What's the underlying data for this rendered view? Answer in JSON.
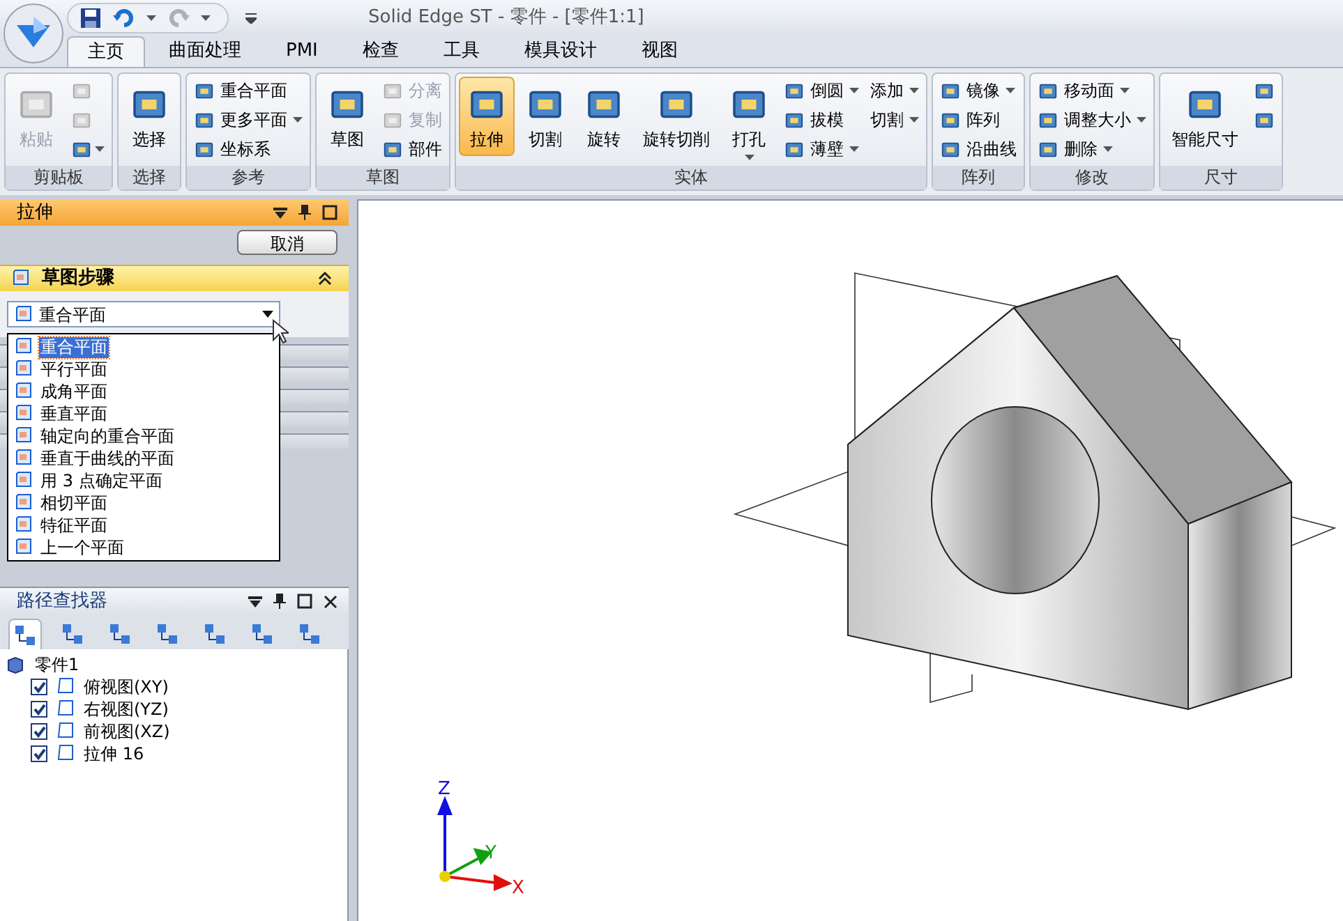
{
  "app_title": "Solid Edge ST - 零件 - [零件1:1]",
  "ribbon_tabs": [
    {
      "label": "主页",
      "selected": true
    },
    {
      "label": "曲面处理",
      "selected": false
    },
    {
      "label": "PMI",
      "selected": false
    },
    {
      "label": "检查",
      "selected": false
    },
    {
      "label": "工具",
      "selected": false
    },
    {
      "label": "模具设计",
      "selected": false
    },
    {
      "label": "视图",
      "selected": false
    }
  ],
  "ribbon_groups": [
    {
      "label": "剪贴板",
      "items": [
        {
          "kind": "large",
          "label": "粘贴",
          "disabled": true,
          "selected": false,
          "dropdown": false
        },
        {
          "kind": "icon",
          "disabled": true,
          "selected": false,
          "dropdown": false
        },
        {
          "kind": "icon",
          "disabled": true,
          "selected": false,
          "dropdown": false
        },
        {
          "kind": "icon",
          "disabled": false,
          "selected": false,
          "dropdown": true
        }
      ]
    },
    {
      "label": "选择",
      "items": [
        {
          "kind": "large",
          "label": "选择",
          "disabled": false,
          "selected": false,
          "dropdown": false
        }
      ]
    },
    {
      "label": "参考",
      "items": [
        {
          "kind": "small",
          "label": "重合平面",
          "disabled": false,
          "selected": false,
          "dropdown": false
        },
        {
          "kind": "small",
          "label": "更多平面",
          "disabled": false,
          "selected": false,
          "dropdown": true
        },
        {
          "kind": "small",
          "label": "坐标系",
          "disabled": false,
          "selected": false,
          "dropdown": false
        }
      ]
    },
    {
      "label": "草图",
      "items": [
        {
          "kind": "large",
          "label": "草图",
          "disabled": false,
          "selected": false,
          "dropdown": false
        },
        {
          "kind": "small",
          "label": "分离",
          "disabled": true,
          "selected": false,
          "dropdown": false
        },
        {
          "kind": "small",
          "label": "复制",
          "disabled": true,
          "selected": false,
          "dropdown": false
        },
        {
          "kind": "small",
          "label": "部件",
          "disabled": false,
          "selected": false,
          "dropdown": false
        }
      ]
    },
    {
      "label": "实体",
      "items": [
        {
          "kind": "large",
          "label": "拉伸",
          "disabled": false,
          "selected": true,
          "dropdown": false
        },
        {
          "kind": "large",
          "label": "切割",
          "disabled": false,
          "selected": false,
          "dropdown": false
        },
        {
          "kind": "large",
          "label": "旋转",
          "disabled": false,
          "selected": false,
          "dropdown": false
        },
        {
          "kind": "large",
          "label": "旋转切削",
          "disabled": false,
          "selected": false,
          "dropdown": false
        },
        {
          "kind": "large",
          "label": "打孔",
          "disabled": false,
          "selected": false,
          "dropdown": true
        },
        {
          "kind": "small",
          "label": "倒圆",
          "disabled": false,
          "selected": false,
          "dropdown": true
        },
        {
          "kind": "small",
          "label": "拔模",
          "disabled": false,
          "selected": false,
          "dropdown": false
        },
        {
          "kind": "small",
          "label": "薄壁",
          "disabled": false,
          "selected": false,
          "dropdown": true
        },
        {
          "kind": "text",
          "label": "添加",
          "disabled": false,
          "selected": false,
          "dropdown": true
        },
        {
          "kind": "text",
          "label": "切割",
          "disabled": false,
          "selected": false,
          "dropdown": true
        }
      ]
    },
    {
      "label": "阵列",
      "items": [
        {
          "kind": "small",
          "label": "镜像",
          "disabled": false,
          "selected": false,
          "dropdown": true
        },
        {
          "kind": "small",
          "label": "阵列",
          "disabled": false,
          "selected": false,
          "dropdown": false
        },
        {
          "kind": "small",
          "label": "沿曲线",
          "disabled": false,
          "selected": false,
          "dropdown": false
        }
      ]
    },
    {
      "label": "修改",
      "items": [
        {
          "kind": "small",
          "label": "移动面",
          "disabled": false,
          "selected": false,
          "dropdown": true
        },
        {
          "kind": "small",
          "label": "调整大小",
          "disabled": false,
          "selected": false,
          "dropdown": true
        },
        {
          "kind": "small",
          "label": "删除",
          "disabled": false,
          "selected": false,
          "dropdown": true
        }
      ]
    },
    {
      "label": "尺寸",
      "items": [
        {
          "kind": "large",
          "label": "智能尺寸",
          "disabled": false,
          "selected": false,
          "dropdown": false
        },
        {
          "kind": "icon",
          "disabled": false,
          "selected": false,
          "dropdown": false
        },
        {
          "kind": "icon",
          "disabled": false,
          "selected": false,
          "dropdown": false
        }
      ]
    }
  ],
  "command_panel": {
    "title": "拉伸",
    "cancel_button": "取消",
    "step_section": {
      "title": "草图步骤",
      "expanded": true
    },
    "plane_combo": {
      "value": "重合平面",
      "options": [
        {
          "label": "重合平面",
          "selected": true
        },
        {
          "label": "平行平面",
          "selected": false
        },
        {
          "label": "成角平面",
          "selected": false
        },
        {
          "label": "垂直平面",
          "selected": false
        },
        {
          "label": "轴定向的重合平面",
          "selected": false
        },
        {
          "label": "垂直于曲线的平面",
          "selected": false
        },
        {
          "label": "用 3 点确定平面",
          "selected": false
        },
        {
          "label": "相切平面",
          "selected": false
        },
        {
          "label": "特征平面",
          "selected": false
        },
        {
          "label": "上一个平面",
          "selected": false
        }
      ]
    }
  },
  "pathfinder": {
    "title": "路径查找器",
    "tabs": [
      {
        "selected": true
      },
      {
        "selected": false
      },
      {
        "selected": false
      },
      {
        "selected": false
      },
      {
        "selected": false
      },
      {
        "selected": false
      },
      {
        "selected": false
      }
    ],
    "tree": {
      "label": "零件1",
      "children": [
        {
          "label": "俯视图(XY)",
          "checked": true
        },
        {
          "label": "右视图(YZ)",
          "checked": true
        },
        {
          "label": "前视图(XZ)",
          "checked": true
        },
        {
          "label": "拉伸 16",
          "checked": true
        }
      ]
    }
  },
  "axes": [
    {
      "label": "Z",
      "color": "#1010e0"
    },
    {
      "label": "Y",
      "color": "#10a010"
    },
    {
      "label": "X",
      "color": "#e01010"
    }
  ]
}
